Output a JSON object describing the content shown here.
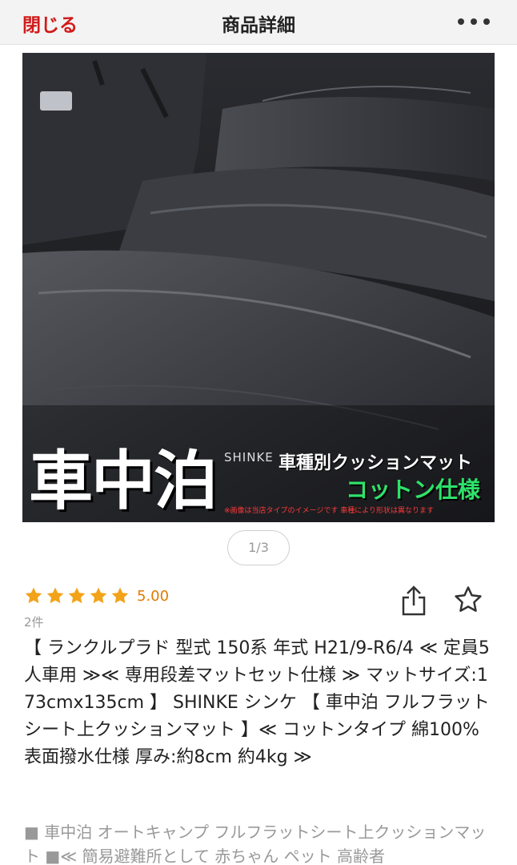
{
  "header": {
    "close_label": "閉じる",
    "title": "商品詳細",
    "more_icon": "ellipsis-icon"
  },
  "photo": {
    "overlay_big": "車中泊",
    "brand": "SHINKE",
    "subtitle": "車種別クッションマット",
    "feature": "コットン仕様",
    "note": "※画像は当店タイプのイメージです 車種により形状は異なります"
  },
  "pager": {
    "text": "1/3",
    "current": 1,
    "total": 3
  },
  "rating": {
    "stars": 5,
    "value": "5.00",
    "count": "2件",
    "star_color": "#f2a31a"
  },
  "actions": {
    "share_icon": "share-icon",
    "favorite_icon": "star-outline-icon"
  },
  "product": {
    "title": "【 ランクルプラド 型式 150系 年式 H21/9-R6/4 ≪ 定員5人車用 ≫≪ 専用段差マットセット仕様 ≫ マットサイズ:173cmx135cm 】 SHINKE シンケ 【 車中泊 フルフラットシート上クッションマット 】≪ コットンタイプ 綿100% 表面撥水仕様 厚み:約8cm 約4kg ≫",
    "description": "■ 車中泊 オートキャンプ フルフラットシート上クッションマット ■≪ 簡易避難所として 赤ちゃん ペット 高齢者"
  },
  "colors": {
    "accent_red": "#d11a1a",
    "rating_orange": "#e07a00",
    "cotton_green": "#2ee26a"
  }
}
